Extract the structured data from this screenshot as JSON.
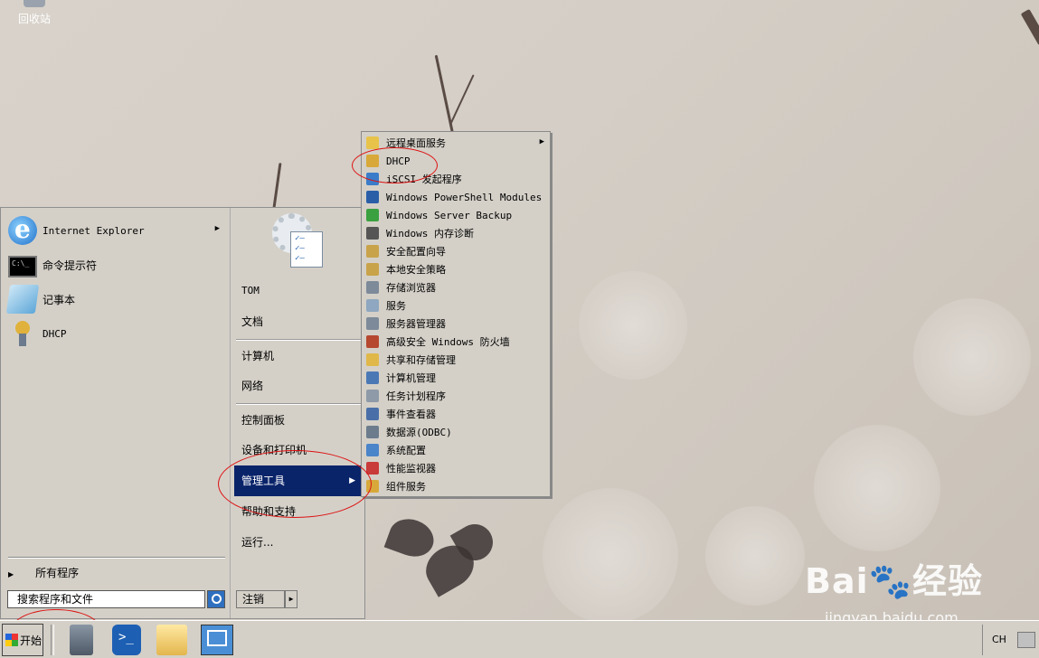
{
  "desktop": {
    "recycle_bin": "回收站",
    "watermark": {
      "brand": "Bai🐾经验",
      "url": "jingyan.baidu.com"
    }
  },
  "start_menu": {
    "pinned": [
      {
        "label": "Internet Explorer",
        "icon": "ie-icon",
        "has_submenu": true
      },
      {
        "label": "命令提示符",
        "icon": "cmd-icon"
      },
      {
        "label": "记事本",
        "icon": "notepad-icon"
      },
      {
        "label": "DHCP",
        "icon": "dhcp-icon"
      }
    ],
    "all_programs": "所有程序",
    "search_placeholder": "搜索程序和文件",
    "right": {
      "user": "TOM",
      "items": {
        "documents": "文档",
        "computer": "计算机",
        "network": "网络",
        "control_panel": "控制面板",
        "devices_printers": "设备和打印机",
        "admin_tools": "管理工具",
        "help": "帮助和支持",
        "run": "运行..."
      },
      "logoff": "注销"
    }
  },
  "admin_submenu": [
    {
      "label": "远程桌面服务",
      "color": "#e8c34a",
      "has_submenu": true
    },
    {
      "label": "DHCP",
      "color": "#d8a93a"
    },
    {
      "label": "iSCSI 发起程序",
      "color": "#3a7cc9"
    },
    {
      "label": "Windows PowerShell Modules",
      "color": "#2a5fa8"
    },
    {
      "label": "Windows Server Backup",
      "color": "#3aa040"
    },
    {
      "label": "Windows 内存诊断",
      "color": "#555555"
    },
    {
      "label": "安全配置向导",
      "color": "#c9a34a"
    },
    {
      "label": "本地安全策略",
      "color": "#c9a34a"
    },
    {
      "label": "存储浏览器",
      "color": "#7d8a99"
    },
    {
      "label": "服务",
      "color": "#8fa7c0"
    },
    {
      "label": "服务器管理器",
      "color": "#7d8a99"
    },
    {
      "label": "高级安全 Windows 防火墙",
      "color": "#b5482f"
    },
    {
      "label": "共享和存储管理",
      "color": "#e0b84a"
    },
    {
      "label": "计算机管理",
      "color": "#4a78b5"
    },
    {
      "label": "任务计划程序",
      "color": "#8f9aa8"
    },
    {
      "label": "事件查看器",
      "color": "#4a6fa8"
    },
    {
      "label": "数据源(ODBC)",
      "color": "#6c7c8c"
    },
    {
      "label": "系统配置",
      "color": "#4a84c9"
    },
    {
      "label": "性能监视器",
      "color": "#c93a3a"
    },
    {
      "label": "组件服务",
      "color": "#d8a93a"
    }
  ],
  "taskbar": {
    "start": "开始",
    "lang": "CH"
  }
}
